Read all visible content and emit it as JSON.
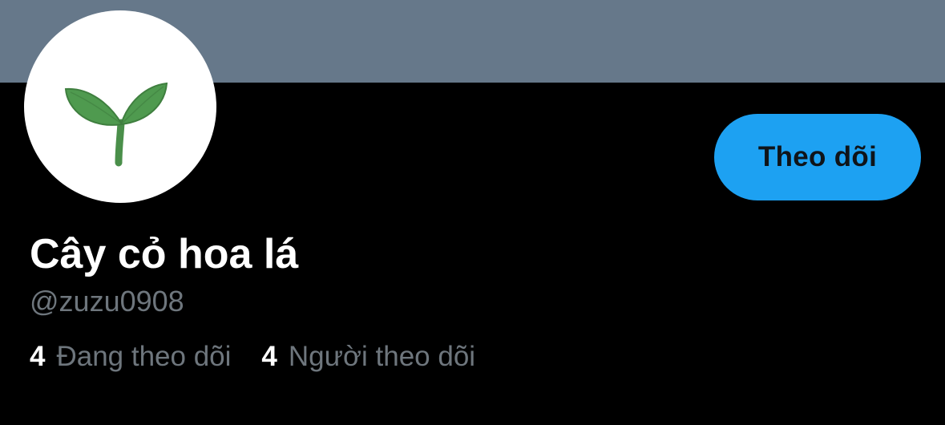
{
  "profile": {
    "display_name": "Cây cỏ hoa lá",
    "handle": "@zuzu0908",
    "avatar_icon": "seedling-icon",
    "follow_button_label": "Theo dõi"
  },
  "stats": {
    "following_count": "4",
    "following_label": "Đang theo dõi",
    "followers_count": "4",
    "followers_label": "Người theo dõi"
  },
  "colors": {
    "banner": "#66788a",
    "background": "#000000",
    "accent": "#1da1f2",
    "muted_text": "#6e767d",
    "primary_text": "#ffffff",
    "leaf_green": "#4f9a4f"
  }
}
